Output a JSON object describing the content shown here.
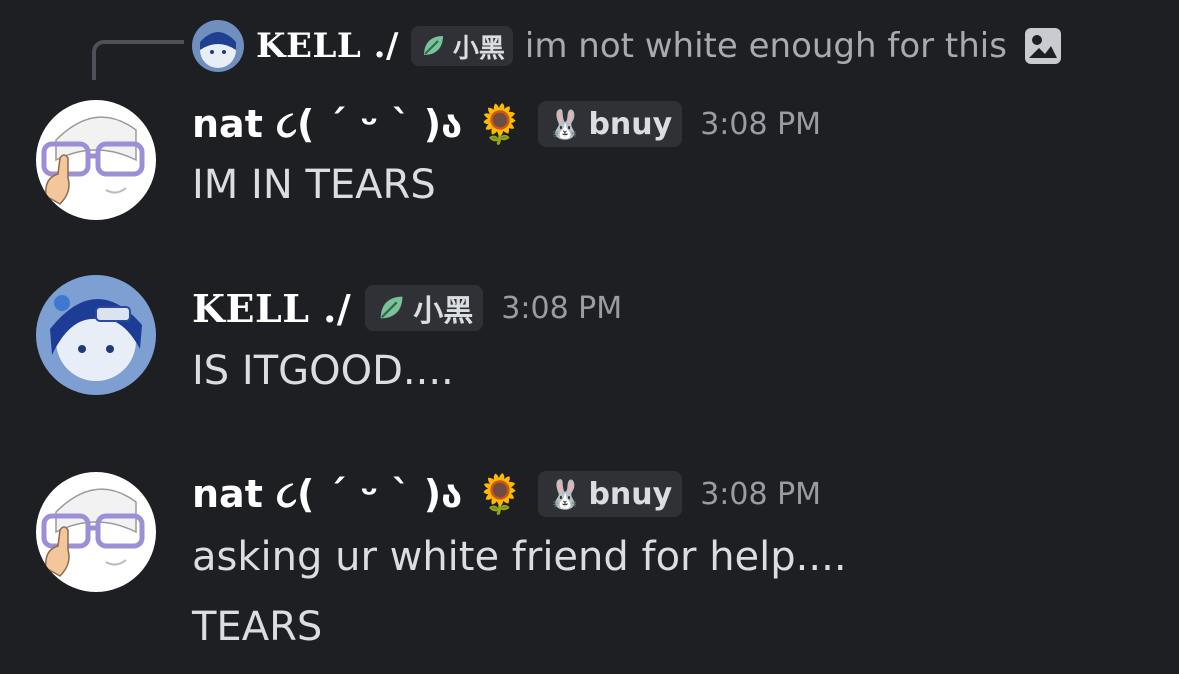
{
  "reply": {
    "author": "KELL ./",
    "role": "小黑",
    "text": "im not white enough for this",
    "attachment_icon": "image-icon"
  },
  "messages": [
    {
      "author": "nat ૮( ˊ ᵕ ˋ )ა",
      "author_emoji": "🌻",
      "role_emoji": "🐰",
      "role": "bnuy",
      "time": "3:08 PM",
      "lines": [
        "IM IN TEARS"
      ]
    },
    {
      "author": "KELL ./",
      "role_icon": "leaf-icon",
      "role": "小黑",
      "time": "3:08 PM",
      "lines": [
        "IS ITGOOD...."
      ]
    },
    {
      "author": "nat ૮( ˊ ᵕ ˋ )ა",
      "author_emoji": "🌻",
      "role_emoji": "🐰",
      "role": "bnuy",
      "time": "3:08 PM",
      "lines": [
        "asking ur white friend for help....",
        "TEARS"
      ]
    }
  ],
  "colors": {
    "background": "#1e1f23",
    "text": "#dbdee1",
    "muted": "#9a9ca3",
    "tag_bg": "#2f3136",
    "leaf": "#7bc29a"
  }
}
